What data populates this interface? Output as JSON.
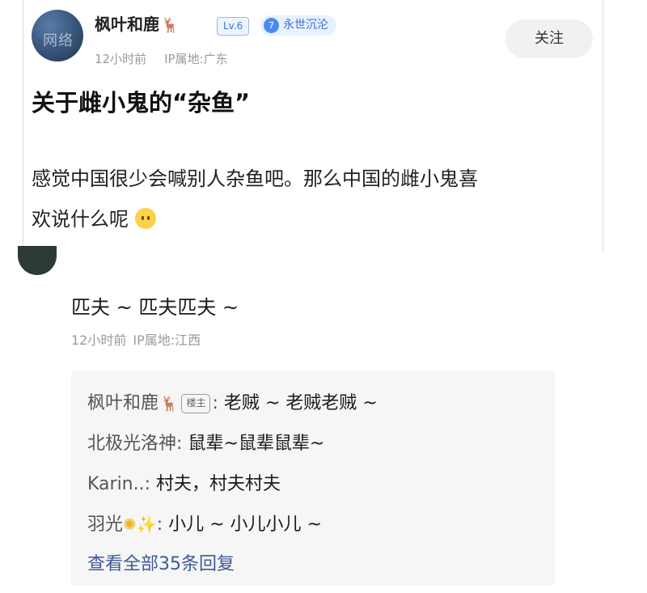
{
  "post": {
    "author": "枫叶和鹿",
    "author_icon": "deer-emoji",
    "level": "Lv.6",
    "title_badge_number": "7",
    "title_badge_text": "永世沉沦",
    "avatar_watermark": "网络",
    "time": "12小时前",
    "ip": "IP属地:广东",
    "follow_label": "关注",
    "title": "关于雌小鬼的“杂鱼”",
    "body_line1": "感觉中国很少会喊别人杂鱼吧。那么中国的雌小鬼喜",
    "body_line2": "欢说什么呢",
    "body_emoji": "flushed-face-emoji"
  },
  "comment": {
    "text": "匹夫 ~ 匹夫匹夫 ~",
    "time": "12小时前",
    "ip": "IP属地:江西",
    "replies": [
      {
        "author": "枫叶和鹿",
        "badge": "楼主",
        "separator": ":",
        "content": "老贼 ~ 老贼老贼 ~"
      },
      {
        "author": "北极光洛神",
        "separator": ":",
        "content": "鼠辈~鼠辈鼠辈~"
      },
      {
        "author": "Karin..",
        "separator": ":",
        "content": "村夫，村夫村夫"
      },
      {
        "author": "羽光",
        "separator": ":",
        "content": "小儿 ~ 小儿小儿 ~"
      }
    ],
    "view_all": "查看全部35条回复"
  },
  "colors": {
    "accent_blue": "#3a6fd6",
    "link_blue": "#3d5a98",
    "meta_gray": "#9a9a9a",
    "reply_bg": "#f6f6f6"
  }
}
